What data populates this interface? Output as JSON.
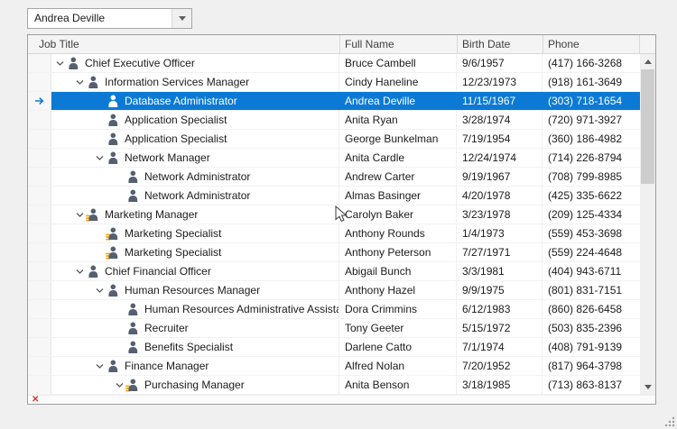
{
  "colors": {
    "selection": "#0c7ad5",
    "orange": "#f2a50c",
    "error": "#d9342b",
    "icon": "#556070"
  },
  "combobox": {
    "value": "Andrea Deville"
  },
  "grid": {
    "columns": [
      "Job Title",
      "Full Name",
      "Birth Date",
      "Phone"
    ],
    "rows": [
      {
        "level": 0,
        "expanded": true,
        "icon": "person",
        "selected": false,
        "job_title": "Chief Executive Officer",
        "full_name": "Bruce Cambell",
        "birth_date": "9/6/1957",
        "phone": "(417) 166-3268"
      },
      {
        "level": 1,
        "expanded": true,
        "icon": "person",
        "selected": false,
        "job_title": "Information Services Manager",
        "full_name": "Cindy Haneline",
        "birth_date": "12/23/1973",
        "phone": "(918) 161-3649"
      },
      {
        "level": 2,
        "expanded": false,
        "icon": "person",
        "selected": true,
        "job_title": "Database Administrator",
        "full_name": "Andrea Deville",
        "birth_date": "11/15/1967",
        "phone": "(303) 718-1654"
      },
      {
        "level": 2,
        "expanded": false,
        "icon": "person",
        "selected": false,
        "job_title": "Application Specialist",
        "full_name": "Anita Ryan",
        "birth_date": "3/28/1974",
        "phone": "(720) 971-3927"
      },
      {
        "level": 2,
        "expanded": false,
        "icon": "person",
        "selected": false,
        "job_title": "Application Specialist",
        "full_name": "George Bunkelman",
        "birth_date": "7/19/1954",
        "phone": "(360) 186-4982"
      },
      {
        "level": 2,
        "expanded": true,
        "icon": "person",
        "selected": false,
        "job_title": "Network Manager",
        "full_name": "Anita Cardle",
        "birth_date": "12/24/1974",
        "phone": "(714) 226-8794"
      },
      {
        "level": 3,
        "expanded": false,
        "icon": "person",
        "selected": false,
        "job_title": "Network Administrator",
        "full_name": "Andrew Carter",
        "birth_date": "9/19/1967",
        "phone": "(708) 799-8985"
      },
      {
        "level": 3,
        "expanded": false,
        "icon": "person",
        "selected": false,
        "job_title": "Network Administrator",
        "full_name": "Almas Basinger",
        "birth_date": "4/20/1978",
        "phone": "(425) 335-6622"
      },
      {
        "level": 1,
        "expanded": true,
        "icon": "person-orange",
        "selected": false,
        "job_title": "Marketing Manager",
        "full_name": "Carolyn Baker",
        "birth_date": "3/23/1978",
        "phone": "(209) 125-4334"
      },
      {
        "level": 2,
        "expanded": false,
        "icon": "person-orange",
        "selected": false,
        "job_title": "Marketing Specialist",
        "full_name": "Anthony Rounds",
        "birth_date": "1/4/1973",
        "phone": "(559) 453-3698"
      },
      {
        "level": 2,
        "expanded": false,
        "icon": "person-orange",
        "selected": false,
        "job_title": "Marketing Specialist",
        "full_name": "Anthony Peterson",
        "birth_date": "7/27/1971",
        "phone": "(559) 224-4648"
      },
      {
        "level": 1,
        "expanded": true,
        "icon": "person",
        "selected": false,
        "job_title": "Chief Financial Officer",
        "full_name": "Abigail Bunch",
        "birth_date": "3/3/1981",
        "phone": "(404) 943-6711"
      },
      {
        "level": 2,
        "expanded": true,
        "icon": "person",
        "selected": false,
        "job_title": "Human Resources Manager",
        "full_name": "Anthony Hazel",
        "birth_date": "9/9/1975",
        "phone": "(801) 831-7151"
      },
      {
        "level": 3,
        "expanded": false,
        "icon": "person",
        "selected": false,
        "job_title": "Human Resources Administrative Assistant",
        "full_name": "Dora Crimmins",
        "birth_date": "6/12/1983",
        "phone": "(860) 826-6458"
      },
      {
        "level": 3,
        "expanded": false,
        "icon": "person",
        "selected": false,
        "job_title": "Recruiter",
        "full_name": "Tony Geeter",
        "birth_date": "5/15/1972",
        "phone": "(503) 835-2396"
      },
      {
        "level": 3,
        "expanded": false,
        "icon": "person",
        "selected": false,
        "job_title": "Benefits Specialist",
        "full_name": "Darlene Catto",
        "birth_date": "7/1/1974",
        "phone": "(408) 791-9139"
      },
      {
        "level": 2,
        "expanded": true,
        "icon": "person",
        "selected": false,
        "job_title": "Finance Manager",
        "full_name": "Alfred Nolan",
        "birth_date": "7/20/1952",
        "phone": "(817) 964-3798"
      },
      {
        "level": 3,
        "expanded": true,
        "icon": "person-orange",
        "selected": false,
        "job_title": "Purchasing Manager",
        "full_name": "Anita Benson",
        "birth_date": "3/18/1985",
        "phone": "(713) 863-8137"
      }
    ]
  },
  "status": {
    "error_glyph": "✕"
  }
}
